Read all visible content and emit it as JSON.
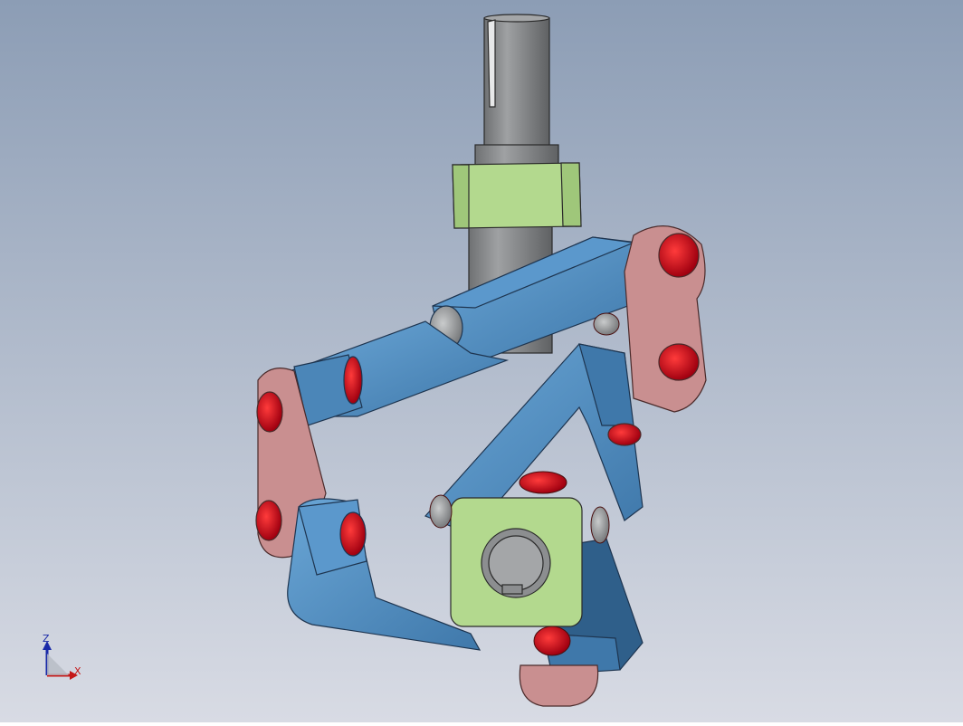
{
  "viewport": {
    "background_top": "#8c9db5",
    "background_bottom": "#d8dbe4",
    "colors": {
      "shaft": "#8c8e90",
      "collar": "#b3d98e",
      "link_blue": "#4b86b8",
      "link_blue_light": "#6aa6d6",
      "link_blue_dark": "#2f5f8a",
      "bracket_pink": "#c98f90",
      "pin_red": "#d0101e",
      "pin_gray": "#9a9c9e"
    }
  },
  "triad": {
    "x_label": "X",
    "z_label": "Z",
    "x_color": "#c41818",
    "z_color": "#1a2aa8"
  }
}
